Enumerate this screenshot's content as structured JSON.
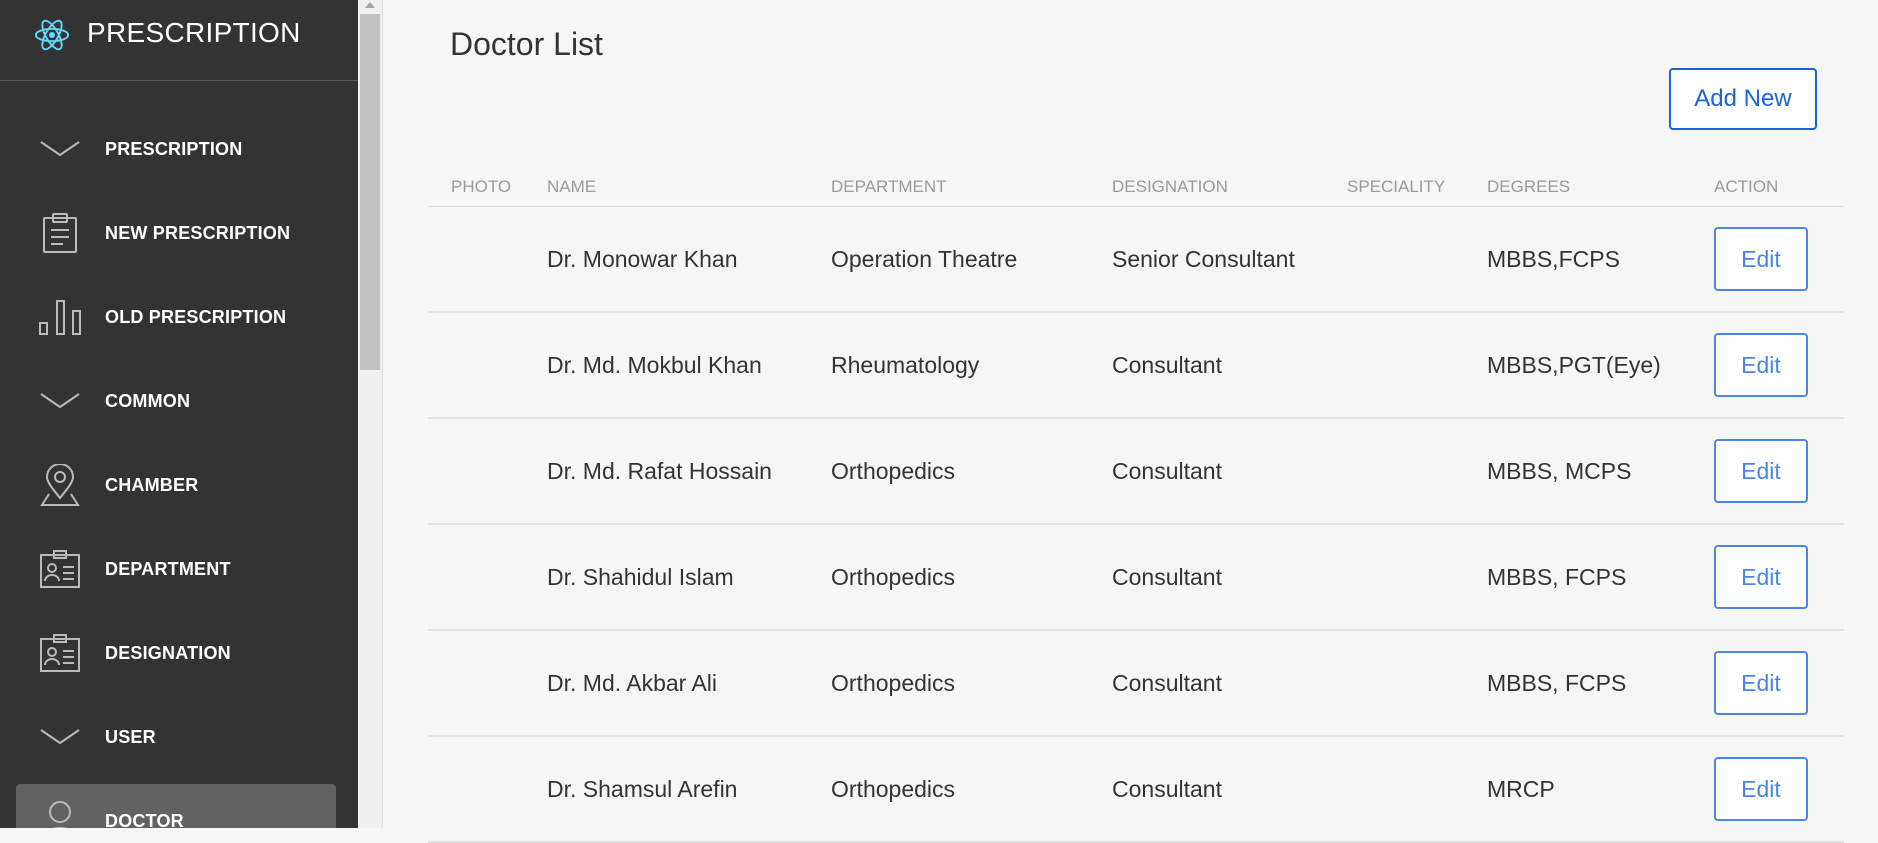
{
  "app": {
    "title": "PRESCRIPTION"
  },
  "sidebar": {
    "items": [
      {
        "label": "PRESCRIPTION",
        "icon": "chevron-down-icon"
      },
      {
        "label": "NEW PRESCRIPTION",
        "icon": "clipboard-icon"
      },
      {
        "label": "OLD PRESCRIPTION",
        "icon": "bar-chart-icon"
      },
      {
        "label": "COMMON",
        "icon": "chevron-down-icon"
      },
      {
        "label": "CHAMBER",
        "icon": "map-pin-icon"
      },
      {
        "label": "DEPARTMENT",
        "icon": "id-card-icon"
      },
      {
        "label": "DESIGNATION",
        "icon": "id-card-icon"
      },
      {
        "label": "USER",
        "icon": "chevron-down-icon"
      },
      {
        "label": "DOCTOR",
        "icon": "user-icon",
        "active": true
      }
    ]
  },
  "main": {
    "title": "Doctor List",
    "add_button": "Add New",
    "table": {
      "headers": [
        "PHOTO",
        "NAME",
        "DEPARTMENT",
        "DESIGNATION",
        "SPECIALITY",
        "DEGREES",
        "ACTION"
      ],
      "action_label": "Edit",
      "rows": [
        {
          "photo": "",
          "name": "Dr. Monowar Khan",
          "department": "Operation Theatre",
          "designation": "Senior Consultant",
          "speciality": "",
          "degrees": "MBBS,FCPS"
        },
        {
          "photo": "",
          "name": "Dr. Md. Mokbul Khan",
          "department": "Rheumatology",
          "designation": "Consultant",
          "speciality": "",
          "degrees": "MBBS,PGT(Eye)"
        },
        {
          "photo": "",
          "name": "Dr. Md. Rafat Hossain",
          "department": "Orthopedics",
          "designation": "Consultant",
          "speciality": "",
          "degrees": "MBBS, MCPS"
        },
        {
          "photo": "",
          "name": "Dr. Shahidul Islam",
          "department": "Orthopedics",
          "designation": "Consultant",
          "speciality": "",
          "degrees": "MBBS, FCPS"
        },
        {
          "photo": "",
          "name": "Dr. Md. Akbar Ali",
          "department": "Orthopedics",
          "designation": "Consultant",
          "speciality": "",
          "degrees": "MBBS, FCPS"
        },
        {
          "photo": "",
          "name": "Dr. Shamsul Arefin",
          "department": "Orthopedics",
          "designation": "Consultant",
          "speciality": "",
          "degrees": "MRCP"
        }
      ]
    }
  },
  "colors": {
    "sidebar_bg": "#333333",
    "active_bg": "#626262",
    "accent": "#1a63d8",
    "logo": "#61dafb"
  }
}
